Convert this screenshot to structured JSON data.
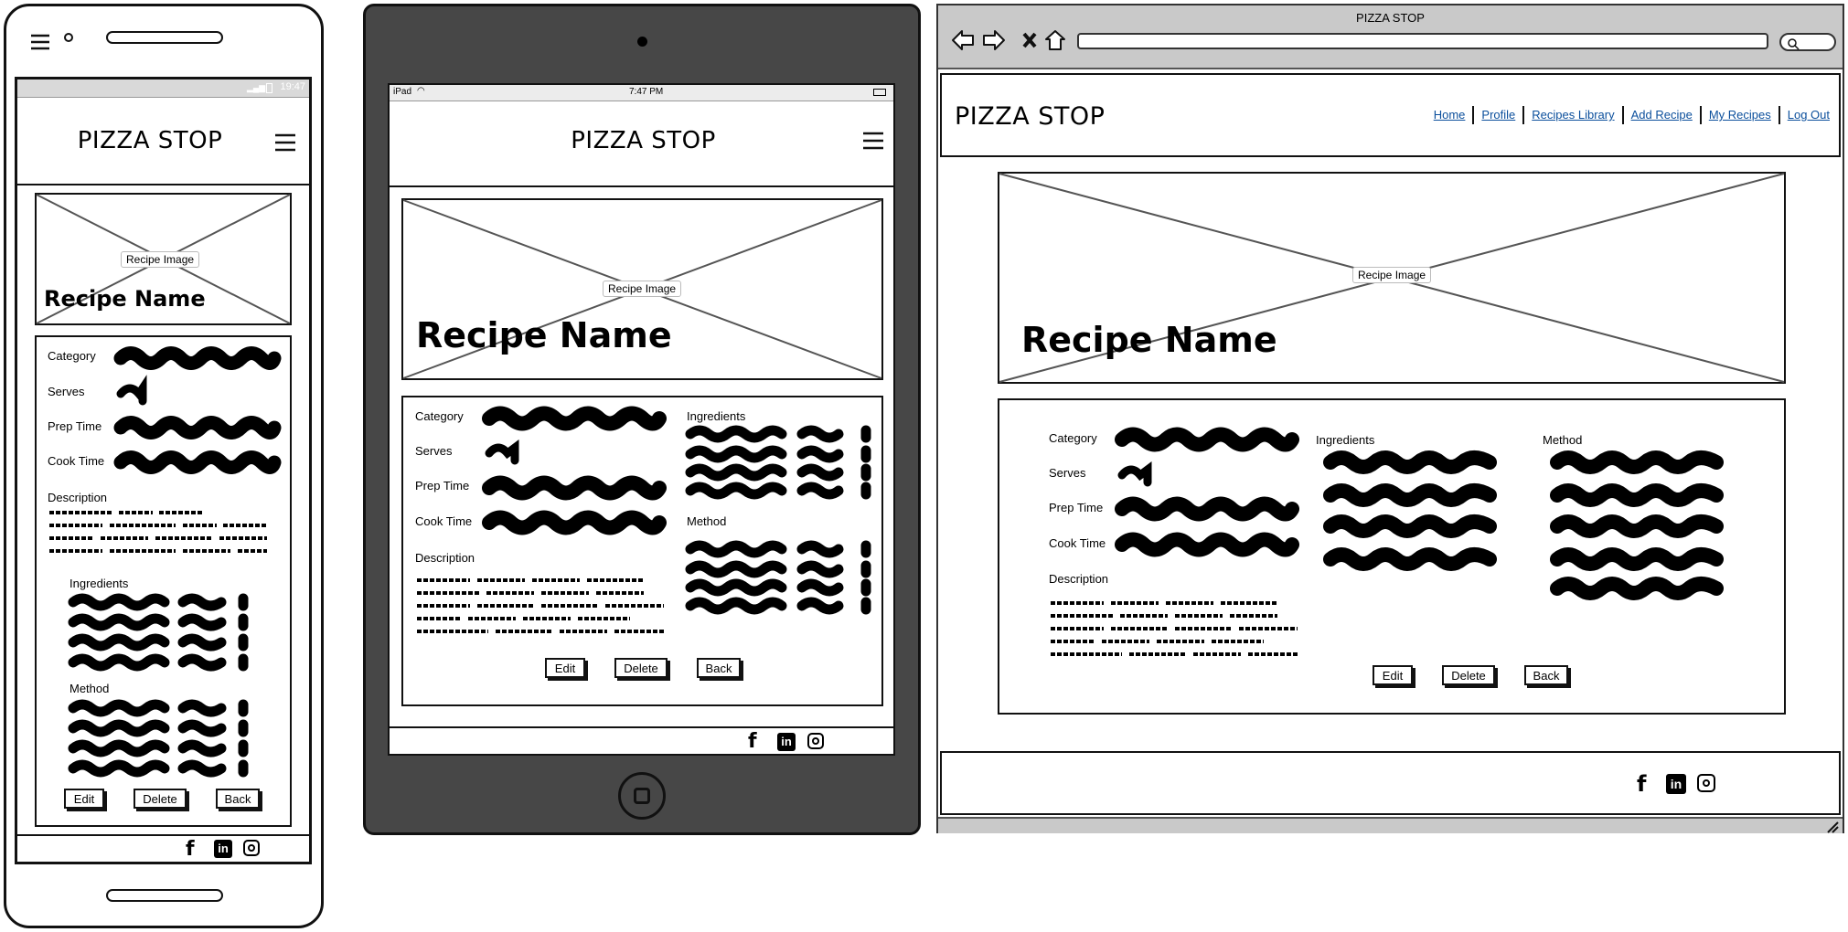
{
  "app_title": "PIZZA STOP",
  "browser": {
    "window_title": "PIZZA STOP"
  },
  "phone_status": {
    "time": "19:47"
  },
  "tablet_status": {
    "device": "iPad",
    "time": "7:47 PM"
  },
  "nav": {
    "links": [
      "Home",
      "Profile",
      "Recipes Library",
      "Add Recipe",
      "My Recipes",
      "Log Out"
    ]
  },
  "recipe": {
    "image_caption": "Recipe Image",
    "name": "Recipe Name",
    "fields": {
      "category": "Category",
      "serves": "Serves",
      "prep_time": "Prep Time",
      "cook_time": "Cook Time",
      "description": "Description",
      "ingredients": "Ingredients",
      "method": "Method"
    }
  },
  "buttons": {
    "edit": "Edit",
    "delete": "Delete",
    "back": "Back"
  },
  "social_icons": [
    "facebook-icon",
    "linkedin-icon",
    "instagram-icon"
  ],
  "colors": {
    "tablet_frame": "#474747",
    "link": "#0b4f9c",
    "status_bar": "#d9d9d9"
  }
}
